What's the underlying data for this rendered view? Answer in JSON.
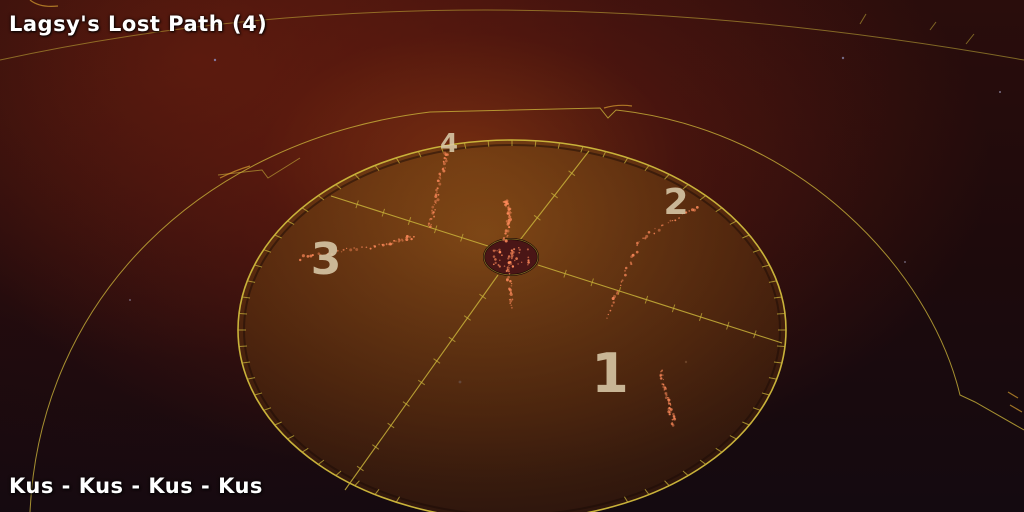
{
  "level": {
    "title": "Lagsy's Lost Path (4)",
    "subtitle": "Kus - Kus - Kus - Kus"
  },
  "sectors": {
    "labels": [
      "1",
      "2",
      "3",
      "4"
    ]
  },
  "colors": {
    "ring_line": "#c9b23a",
    "disc_fill": "#6b3a10",
    "spark": "#ff8a5a"
  }
}
